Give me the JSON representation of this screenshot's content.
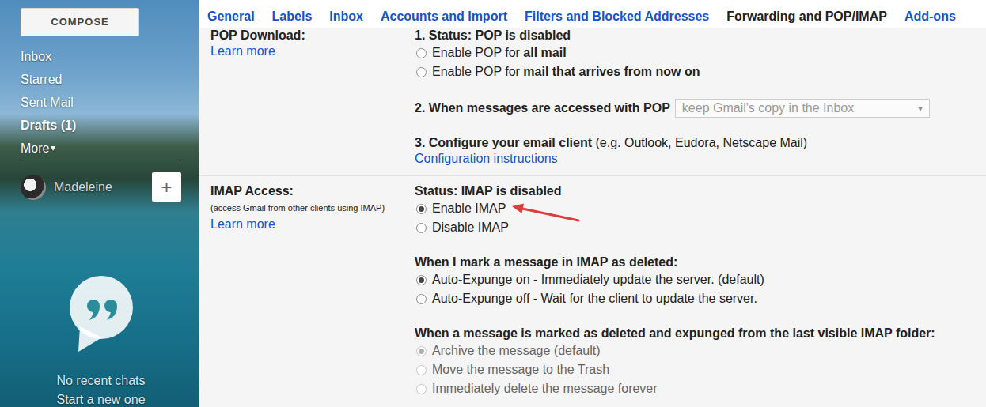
{
  "compose": "COMPOSE",
  "sidebar": {
    "items": [
      {
        "label": "Inbox",
        "bold": false
      },
      {
        "label": "Starred",
        "bold": false
      },
      {
        "label": "Sent Mail",
        "bold": false
      },
      {
        "label": "Drafts (1)",
        "bold": true
      }
    ]
  },
  "more": {
    "label": "More",
    "caret": "▾"
  },
  "user": {
    "name": "Madeleine",
    "add": "+"
  },
  "chat": {
    "lines": [
      "No recent chats",
      "Start a new one"
    ]
  },
  "tabs": [
    {
      "label": "General",
      "selected": false
    },
    {
      "label": "Labels",
      "selected": false
    },
    {
      "label": "Inbox",
      "selected": false
    },
    {
      "label": "Accounts and Import",
      "selected": false
    },
    {
      "label": "Filters and Blocked Addresses",
      "selected": false
    },
    {
      "label": "Forwarding and POP/IMAP",
      "selected": true
    },
    {
      "label": "Add-ons",
      "selected": false
    }
  ],
  "sections": [
    {
      "label": "POP Download:",
      "learn_more": "Learn more",
      "items": [
        {
          "kind": "heading",
          "parts": [
            {
              "text": "1. Status: POP is disabled",
              "bold": true
            }
          ]
        },
        {
          "kind": "radio",
          "selected": false,
          "disabled": false,
          "highlighted": false,
          "parts": [
            {
              "text": "Enable POP for ",
              "bold": false
            },
            {
              "text": "all mail",
              "bold": true
            }
          ]
        },
        {
          "kind": "radio",
          "selected": false,
          "disabled": false,
          "highlighted": false,
          "parts": [
            {
              "text": "Enable POP for ",
              "bold": false
            },
            {
              "text": "mail that arrives from now on",
              "bold": true
            }
          ]
        },
        {
          "kind": "select",
          "label": "2. When messages are accessed with POP",
          "value": "keep Gmail's copy in the Inbox",
          "arrow": "▾",
          "disabled": true
        },
        {
          "kind": "heading",
          "parts": [
            {
              "text": "3. Configure your email client",
              "bold": true
            },
            {
              "text": " (e.g. Outlook, Eudora, Netscape Mail)",
              "bold": false
            }
          ]
        },
        {
          "kind": "link",
          "text": "Configuration instructions"
        }
      ]
    },
    {
      "label": "IMAP Access:",
      "note": "(access Gmail from other clients using IMAP)",
      "learn_more": "Learn more",
      "items": [
        {
          "kind": "heading",
          "parts": [
            {
              "text": "Status: IMAP is disabled",
              "bold": true
            }
          ]
        },
        {
          "kind": "radio",
          "selected": true,
          "disabled": false,
          "highlighted": true,
          "parts": [
            {
              "text": "Enable IMAP",
              "bold": false
            }
          ]
        },
        {
          "kind": "radio",
          "selected": false,
          "disabled": false,
          "highlighted": false,
          "parts": [
            {
              "text": "Disable IMAP",
              "bold": false
            }
          ]
        },
        {
          "kind": "heading",
          "parts": [
            {
              "text": "When I mark a message in IMAP as deleted:",
              "bold": true
            }
          ]
        },
        {
          "kind": "radio",
          "selected": true,
          "disabled": false,
          "highlighted": false,
          "parts": [
            {
              "text": "Auto-Expunge on - Immediately update the server. (default)",
              "bold": false
            }
          ]
        },
        {
          "kind": "radio",
          "selected": false,
          "disabled": false,
          "highlighted": false,
          "parts": [
            {
              "text": "Auto-Expunge off - Wait for the client to update the server.",
              "bold": false
            }
          ]
        },
        {
          "kind": "heading",
          "parts": [
            {
              "text": "When a message is marked as deleted and expunged from the last visible IMAP folder:",
              "bold": true
            }
          ]
        },
        {
          "kind": "radio",
          "selected": true,
          "disabled": true,
          "highlighted": false,
          "parts": [
            {
              "text": "Archive the message (default)",
              "bold": false
            }
          ]
        },
        {
          "kind": "radio",
          "selected": false,
          "disabled": true,
          "highlighted": false,
          "parts": [
            {
              "text": "Move the message to the Trash",
              "bold": false
            }
          ]
        },
        {
          "kind": "radio",
          "selected": false,
          "disabled": true,
          "highlighted": false,
          "parts": [
            {
              "text": "Immediately delete the message forever",
              "bold": false
            }
          ]
        }
      ]
    }
  ]
}
